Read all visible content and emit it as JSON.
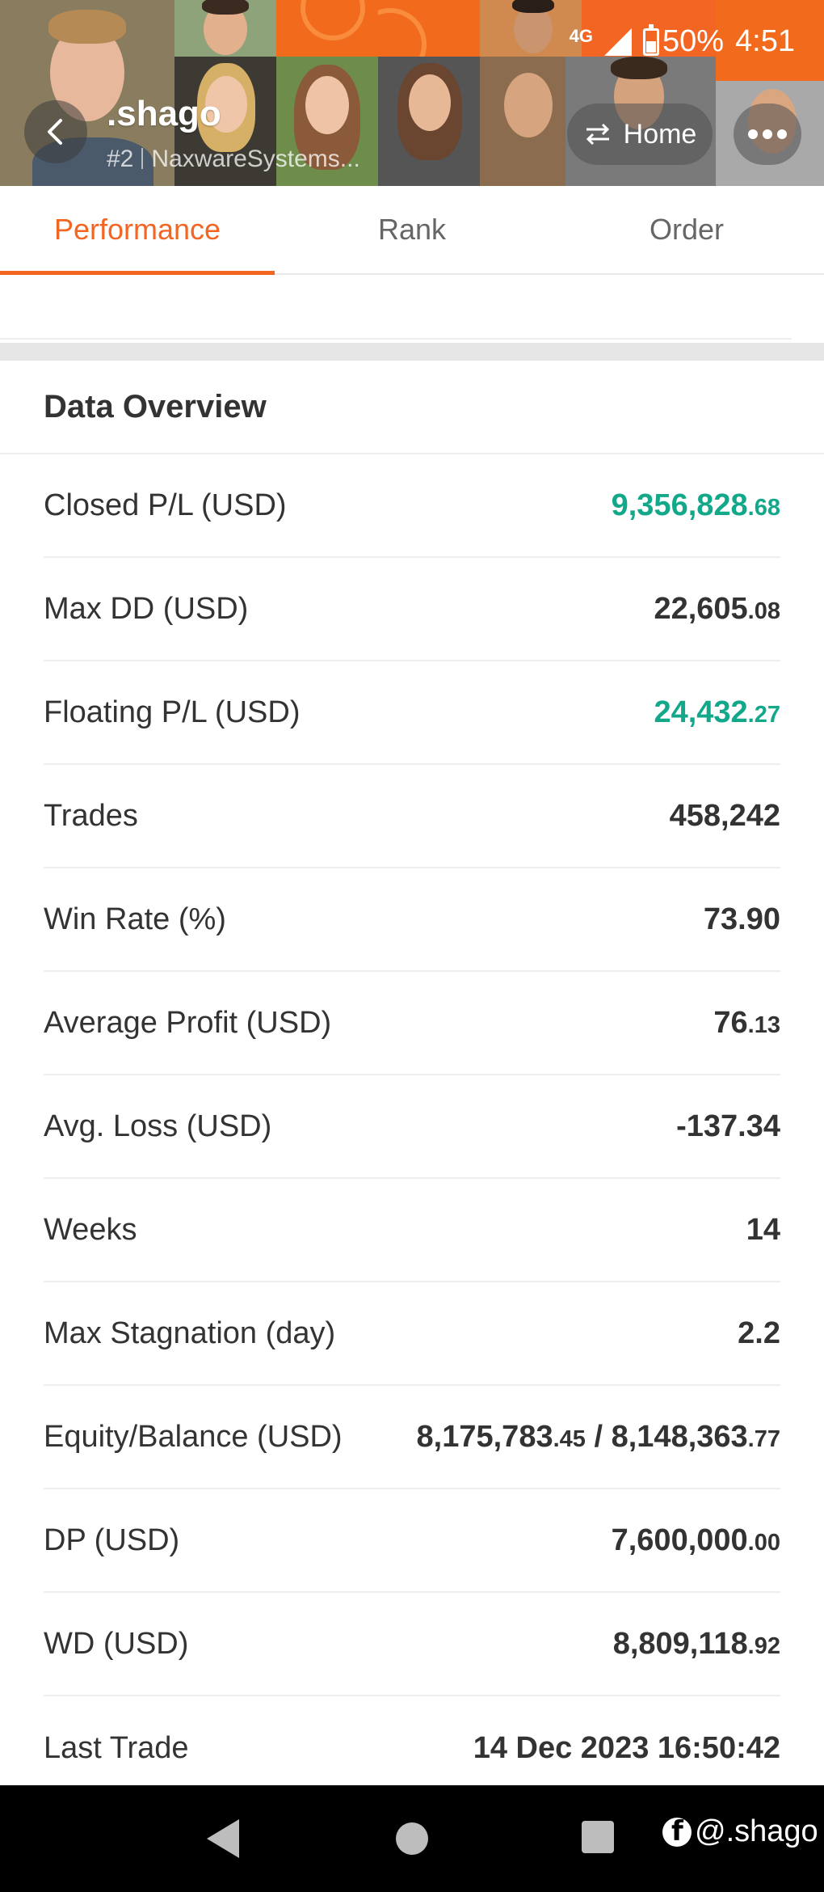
{
  "status_bar": {
    "network": "4G",
    "battery": "50%",
    "time": "4:51"
  },
  "header": {
    "name": ".shago",
    "rank": "#2",
    "company": "NaxwareSystems...",
    "home_label": "Home"
  },
  "tabs": [
    {
      "label": "Performance",
      "active": true
    },
    {
      "label": "Rank",
      "active": false
    },
    {
      "label": "Order",
      "active": false
    }
  ],
  "overview": {
    "title": "Data Overview",
    "rows": [
      {
        "label": "Closed P/L (USD)",
        "int": "9,356,828",
        "dec": ".68",
        "color": "#14a88a"
      },
      {
        "label": "Max DD (USD)",
        "int": "22,605",
        "dec": ".08"
      },
      {
        "label": "Floating P/L (USD)",
        "int": "24,432",
        "dec": ".27",
        "color": "#14a88a"
      },
      {
        "label": "Trades",
        "int": "458,242",
        "dec": ""
      },
      {
        "label": "Win Rate (%)",
        "int": "73.90",
        "dec": ""
      },
      {
        "label": "Average Profit (USD)",
        "int": "76",
        "dec": ".13"
      },
      {
        "label": "Avg. Loss (USD)",
        "int": "-137.34",
        "dec": ""
      },
      {
        "label": "Weeks",
        "int": "14",
        "dec": ""
      },
      {
        "label": "Max Stagnation (day)",
        "int": "2.2",
        "dec": ""
      },
      {
        "label": "Equity/Balance (USD)",
        "int": "8,175,783",
        "dec": ".45",
        "int2": "8,148,363",
        "dec2": ".77"
      },
      {
        "label": "DP (USD)",
        "int": "7,600,000",
        "dec": ".00"
      },
      {
        "label": "WD (USD)",
        "int": "8,809,118",
        "dec": ".92"
      },
      {
        "label": "Last Trade",
        "int": "14 Dec 2023 16:50:42",
        "dec": ""
      }
    ]
  },
  "watermark": "@.shago",
  "colors": {
    "accent": "#f26522",
    "positive": "#14a88a"
  }
}
